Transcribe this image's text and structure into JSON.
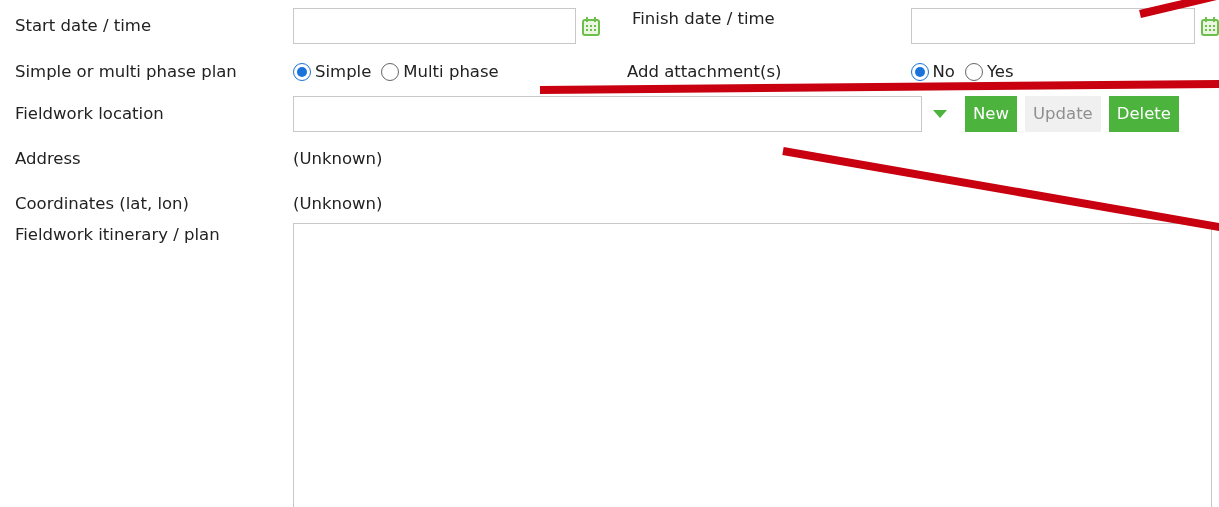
{
  "start": {
    "label": "Start date / time"
  },
  "finish": {
    "label": "Finish date / time"
  },
  "plan_type": {
    "label": "Simple or multi phase plan",
    "options": [
      {
        "label": "Simple",
        "selected": true
      },
      {
        "label": "Multi phase",
        "selected": false
      }
    ]
  },
  "attachments": {
    "label": "Add attachment(s)",
    "options": [
      {
        "label": "No",
        "selected": true
      },
      {
        "label": "Yes",
        "selected": false
      }
    ]
  },
  "location": {
    "label": "Fieldwork location",
    "buttons": [
      {
        "label": "New",
        "disabled": false
      },
      {
        "label": "Update",
        "disabled": true
      },
      {
        "label": "Delete",
        "disabled": false
      }
    ]
  },
  "address": {
    "label": "Address",
    "value": "(Unknown)"
  },
  "coordinates": {
    "label": "Coordinates (lat, lon)",
    "value": "(Unknown)"
  },
  "itinerary": {
    "label": "Fieldwork itinerary / plan"
  }
}
